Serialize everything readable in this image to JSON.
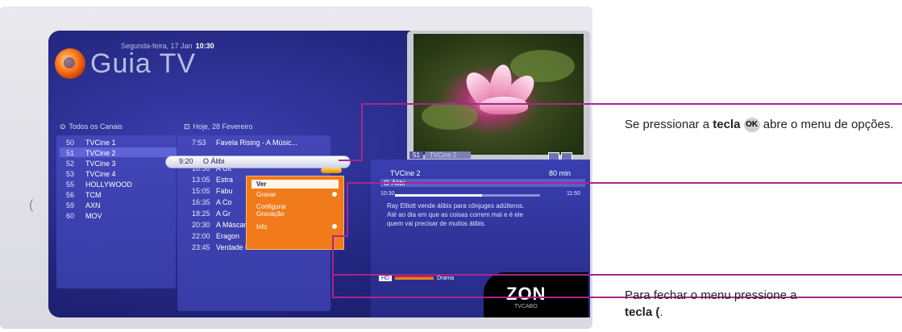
{
  "header": {
    "app_title": "Guia TV",
    "date": "Segunda-feira, 17 Jan",
    "time": "10:30"
  },
  "channels_panel": {
    "title": "Todos os Canais",
    "items": [
      {
        "num": "50",
        "name": "TVCine 1"
      },
      {
        "num": "51",
        "name": "TVCine 2"
      },
      {
        "num": "52",
        "name": "TVCine 3"
      },
      {
        "num": "53",
        "name": "TVCine 4"
      },
      {
        "num": "55",
        "name": "HOLLYWOOD"
      },
      {
        "num": "56",
        "name": "TCM"
      },
      {
        "num": "59",
        "name": "AXN"
      },
      {
        "num": "60",
        "name": "MOV"
      }
    ],
    "selected_index": 1
  },
  "programs_panel": {
    "title": "Hoje, 28 Fevereiro",
    "items": [
      {
        "time": "7:53",
        "title": "Favela Rising - A Músic..."
      },
      {
        "time": "9:20",
        "title": "O Álibi"
      },
      {
        "time": "10:50",
        "title": "A Últ"
      },
      {
        "time": "13:05",
        "title": "Estra"
      },
      {
        "time": "15:05",
        "title": "Fabu"
      },
      {
        "time": "16:35",
        "title": "A Co"
      },
      {
        "time": "18:25",
        "title": "A Gr"
      },
      {
        "time": "20:30",
        "title": "A Máscara De Cristal"
      },
      {
        "time": "22:00",
        "title": "Eragon"
      },
      {
        "time": "23:45",
        "title": "Verdade E Mentira"
      }
    ],
    "selected_index": 1
  },
  "options_menu": {
    "items": [
      "Ver",
      "Gravar",
      "Configurar Gravação",
      "Info"
    ],
    "selected_index": 0
  },
  "preview": {
    "channel_num": "51",
    "channel_name": "TVCine 2"
  },
  "info_panel": {
    "channel": "TVCine 2",
    "duration": "80 min",
    "program": "O Álibi",
    "start": "10:30",
    "end": "11:50",
    "progress": 0.6,
    "description": "Ray Elliott vende álibis para cônjuges adúlteros. Até ao dia em que as coisas correm mal e é ele quem vai precisar de muitos álibis.",
    "hd": "HD",
    "genre": "Drama"
  },
  "brand": {
    "name": "ZON",
    "sub": "TVCABO"
  },
  "annotations": {
    "note1_a": "Se pressionar a",
    "note1_key_word": "tecla",
    "note1_key": "OK",
    "note1_b": "abre o menu de opções.",
    "note2_a": "Para fechar o menu pressione a",
    "note2_key_word": "tecla",
    "note2_b": "."
  },
  "colors": {
    "accent": "#a5288e",
    "menu": "#f17b1b",
    "screen": "#23267e"
  }
}
